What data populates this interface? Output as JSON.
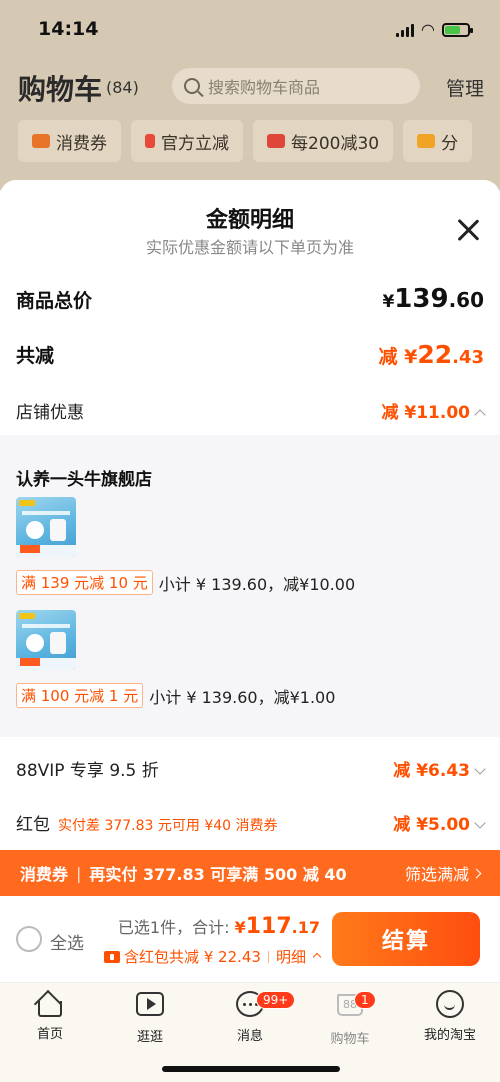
{
  "status_bar": {
    "time": "14:14"
  },
  "background": {
    "title": "购物车",
    "count": "(84)",
    "search_placeholder": "搜索购物车商品",
    "manage": "管理",
    "chips": [
      "消费券",
      "官方立减",
      "每200减30",
      "分"
    ]
  },
  "sheet": {
    "title": "金额明细",
    "subtitle": "实际优惠金额请以下单页为准",
    "total_label": "商品总价",
    "total_currency": "¥",
    "total_int": "139",
    "total_dec": ".60",
    "reduce_label": "共减",
    "reduce_prefix": "减 ¥",
    "reduce_int": "22",
    "reduce_dec": ".43",
    "shop_discount_label": "店铺优惠",
    "shop_discount_value": "减 ¥11.00",
    "shop": {
      "name": "认养一头牛旗舰店",
      "items": [
        {
          "promo": "满 139 元减 10 元",
          "detail": "小计 ¥ 139.60，减¥10.00"
        },
        {
          "promo": "满 100 元减 1 元",
          "detail": "小计 ¥ 139.60，减¥1.00"
        }
      ]
    },
    "vip_label": "88VIP 专享 9.5 折",
    "vip_value": "减 ¥6.43",
    "redpacket_label": "红包",
    "redpacket_note": "实付差 377.83 元可用 ¥40 消费券",
    "redpacket_value": "减 ¥5.00"
  },
  "banner": {
    "tag": "消费券",
    "text": "再实付 377.83 可享满 500 减 40",
    "filter": "筛选满减"
  },
  "checkout": {
    "select_all": "全选",
    "selected_text": "已选1件，合计: ",
    "total_currency": "¥",
    "total_int": "117",
    "total_dec": ".17",
    "detail_text": "含红包共减 ¥ 22.43",
    "detail_link": "明细",
    "pay_button": "结算"
  },
  "tabbar": {
    "tabs": [
      {
        "label": "首页",
        "icon": "home-icon"
      },
      {
        "label": "逛逛",
        "icon": "play-icon"
      },
      {
        "label": "消息",
        "icon": "message-icon",
        "badge": "99+"
      },
      {
        "label": "购物车",
        "icon": "cart-icon",
        "badge": "1",
        "icon_text": "88"
      },
      {
        "label": "我的淘宝",
        "icon": "smile-icon"
      }
    ]
  },
  "colors": {
    "accent": "#ff5000",
    "banner": "#ff6a1f",
    "sheet_bg": "#ffffff",
    "shop_bg": "#f6f6f8"
  }
}
